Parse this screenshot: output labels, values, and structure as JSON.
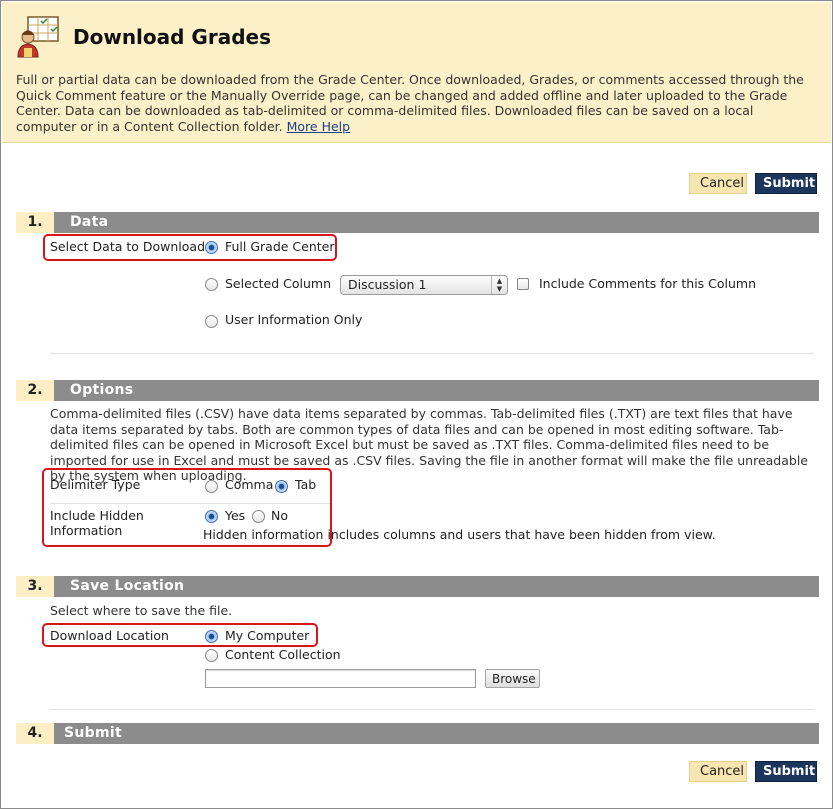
{
  "header": {
    "title": "Download Grades",
    "intro": "Full or partial data can be downloaded from the Grade Center. Once downloaded, Grades, or comments accessed through the Quick Comment feature or the Manually Override page, can be changed and added offline and later uploaded to the Grade Center. Data can be downloaded as tab-delimited or comma-delimited files. Downloaded files can be saved on a local computer or in a Content Collection folder.",
    "more_help": "More Help",
    "icon": "grade-center-person-icon"
  },
  "actions": {
    "cancel": "Cancel",
    "submit": "Submit"
  },
  "sections": {
    "data": {
      "number": "1.",
      "title": "Data",
      "select_label": "Select Data to Download",
      "options": {
        "full": "Full Grade Center",
        "selected": "Selected Column",
        "user_info": "User Information Only"
      },
      "column_select": "Discussion 1",
      "include_comments": "Include Comments for this Column",
      "selected_option": "full"
    },
    "options": {
      "number": "2.",
      "title": "Options",
      "description": "Comma-delimited files (.CSV) have data items separated by commas. Tab-delimited files (.TXT) are text files that have data items separated by tabs. Both are common types of data files and can be opened in most editing software. Tab-delimited files can be opened in Microsoft Excel but must be saved as .TXT files. Comma-delimited files need to be imported for use in Excel and must be saved as .CSV files. Saving the file in another format will make the file unreadable by the system when uploading.",
      "delimiter_label": "Delimiter Type",
      "delimiter_comma": "Comma",
      "delimiter_tab": "Tab",
      "delimiter_selected": "Tab",
      "hidden_label": "Include Hidden Information",
      "hidden_yes": "Yes",
      "hidden_no": "No",
      "hidden_selected": "Yes",
      "hidden_help": "Hidden information includes columns and users that have been hidden from view."
    },
    "save": {
      "number": "3.",
      "title": "Save Location",
      "instruction": "Select where to save the file.",
      "location_label": "Download Location",
      "my_computer": "My Computer",
      "content_collection": "Content Collection",
      "selected": "My Computer",
      "path_value": "",
      "browse": "Browse"
    },
    "submit": {
      "number": "4.",
      "title": "Submit"
    }
  },
  "colors": {
    "header_bg": "#fcf0c8",
    "section_bar": "#8c8c8c",
    "submit_bg": "#1b355c",
    "cancel_bg": "#f8e6b0",
    "highlight": "#d9151c"
  }
}
